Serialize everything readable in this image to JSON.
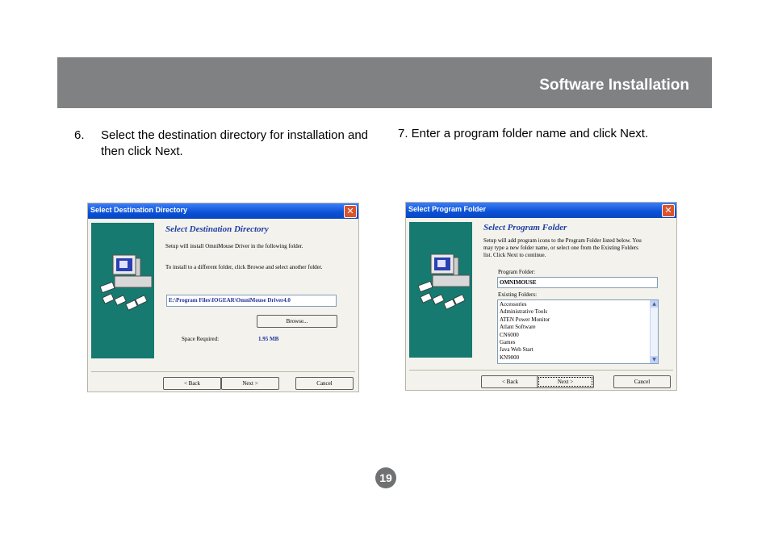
{
  "header": {
    "title": "Software Installation"
  },
  "steps": {
    "step6_number": "6.",
    "step6_text": "Select the destination directory for installation and then click Next.",
    "step7_text": "7. Enter a program folder name and click Next."
  },
  "dialog1": {
    "title": "Select Destination Directory",
    "heading": "Select Destination Directory",
    "line1": "Setup will install OmniMouse Driver in the following folder.",
    "line2": "To install to a different folder, click Browse and select another folder.",
    "path_value": "E:\\Program Files\\IOGEAR\\OmniMouse Driver4.0",
    "browse_label": "Browse...",
    "space_label": "Space Required:",
    "space_value": "1.95 MB",
    "back_label": "< Back",
    "next_label": "Next >",
    "cancel_label": "Cancel"
  },
  "dialog2": {
    "title": "Select Program Folder",
    "heading": "Select Program Folder",
    "line1": "Setup will add program icons to the Program Folder listed below. You",
    "line2": "may type a new folder name, or select one from the Existing Folders",
    "line3": "list.  Click Next to continue.",
    "program_folder_label": "Program Folder:",
    "program_folder_value": "OMNIMOUSE",
    "existing_label": "Existing Folders:",
    "existing_folders": [
      "Accessories",
      "Administrative Tools",
      "ATEN Power Monitor",
      "Atlant Software",
      "CN6000",
      "Games",
      "Java Web Start",
      "KN9000"
    ],
    "back_label": "< Back",
    "next_label": "Next >",
    "cancel_label": "Cancel"
  },
  "page_number": "19",
  "colors": {
    "header_bg": "#7f8183",
    "dialog_titlebar": "#0a51d6",
    "art_panel": "#167a70",
    "heading_blue": "#1f3fa3"
  }
}
